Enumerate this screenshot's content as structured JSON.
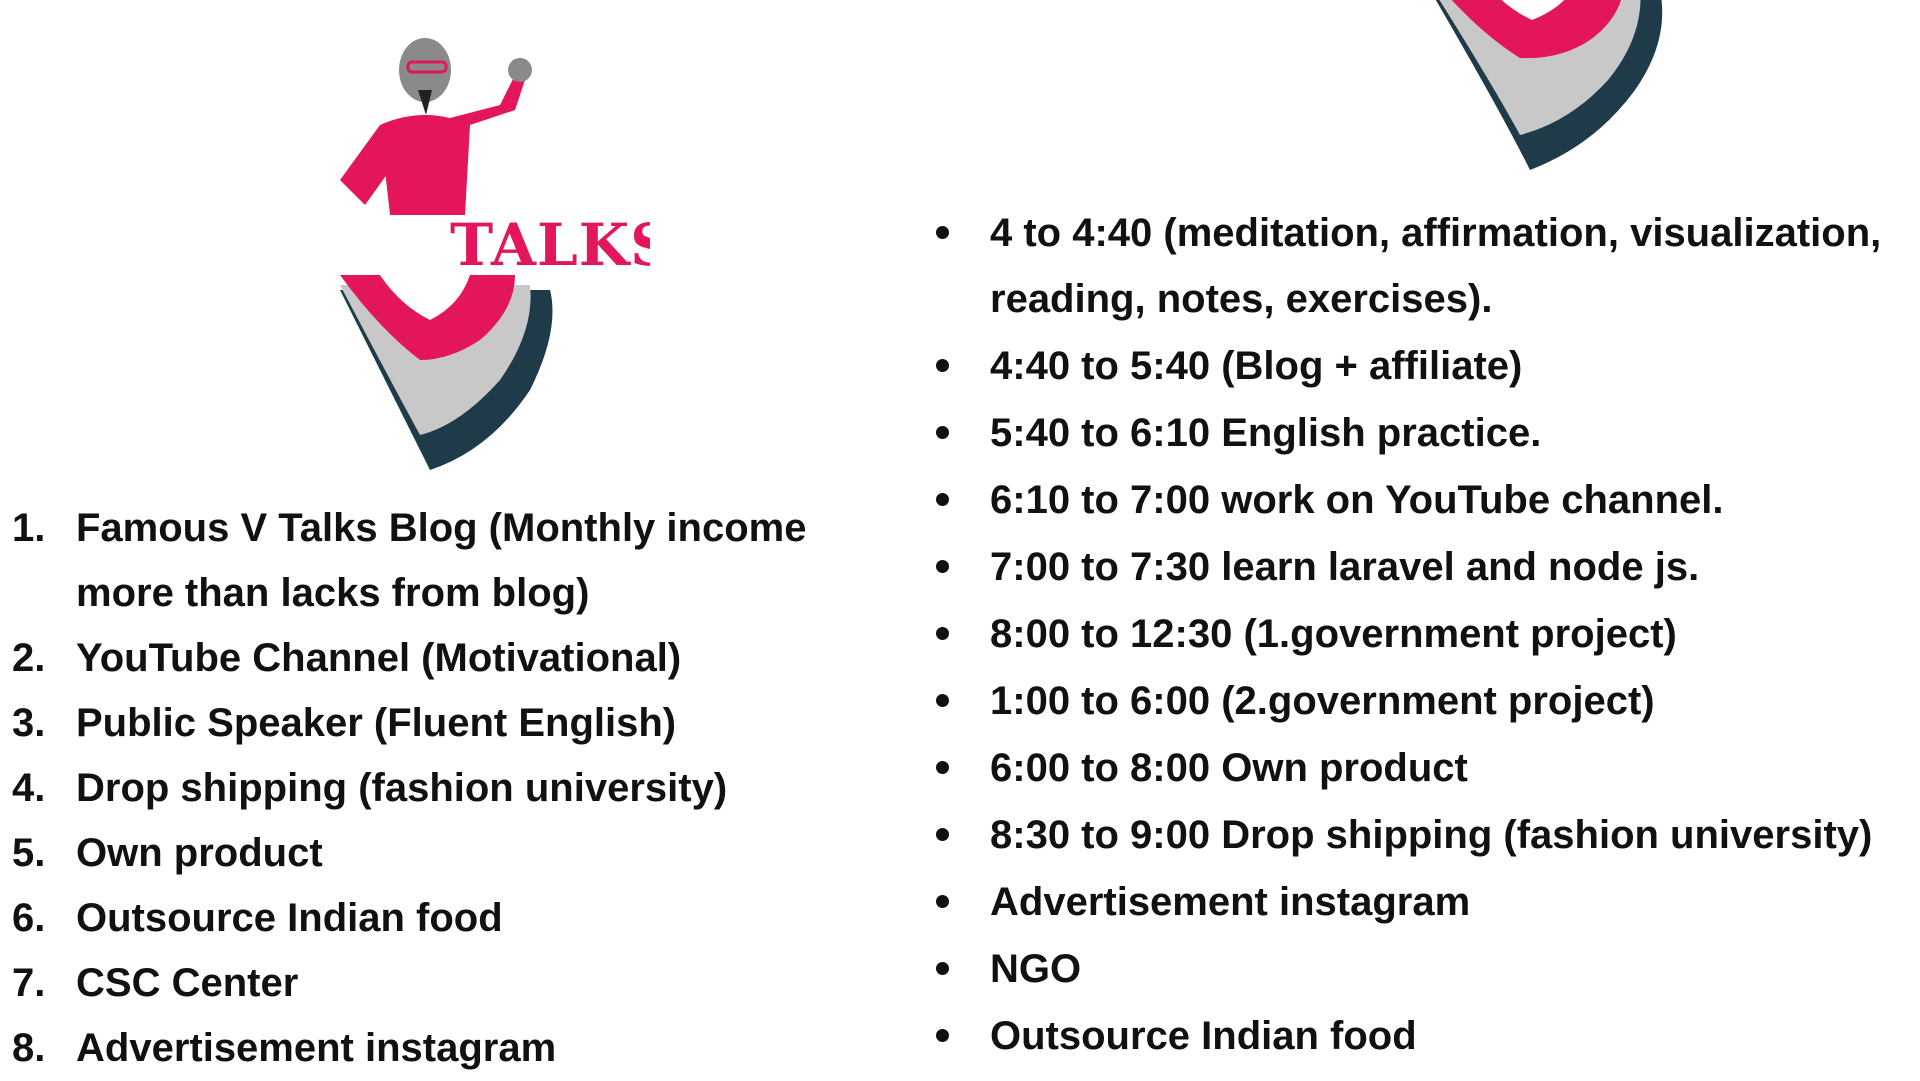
{
  "logo": {
    "text": "TALKS",
    "colors": {
      "pink": "#e3165b",
      "grey": "#c8c8c8",
      "dark": "#1f3a48",
      "skin": "#8a8a8a"
    }
  },
  "goals": [
    {
      "num": "1.",
      "text": "Famous V Talks Blog (Monthly income more than lacks from blog)"
    },
    {
      "num": "2.",
      "text": "YouTube Channel (Motivational)"
    },
    {
      "num": "3.",
      "text": "Public Speaker (Fluent English)"
    },
    {
      "num": "4.",
      "text": "Drop shipping (fashion university)"
    },
    {
      "num": "5.",
      "text": "Own product"
    },
    {
      "num": "6.",
      "text": "Outsource Indian food"
    },
    {
      "num": "7.",
      "text": "CSC Center"
    },
    {
      "num": "8.",
      "text": "Advertisement instagram"
    }
  ],
  "schedule": [
    {
      "text": "4 to 4:40 (meditation, affirmation, visualization, reading, notes, exercises)."
    },
    {
      "text": "4:40 to 5:40 (Blog + affiliate)"
    },
    {
      "text": "5:40 to 6:10 English practice."
    },
    {
      "text": "6:10 to 7:00 work on YouTube channel."
    },
    {
      "text": "7:00 to 7:30 learn laravel and node js."
    },
    {
      "text": "8:00 to 12:30 (1.government project)"
    },
    {
      "text": "1:00 to 6:00 (2.government project)"
    },
    {
      "text": "6:00 to 8:00 Own product"
    },
    {
      "text": "8:30 to 9:00 Drop shipping (fashion university)"
    },
    {
      "text": "Advertisement instagram"
    },
    {
      "text": "NGO"
    },
    {
      "text": "Outsource Indian food"
    }
  ]
}
